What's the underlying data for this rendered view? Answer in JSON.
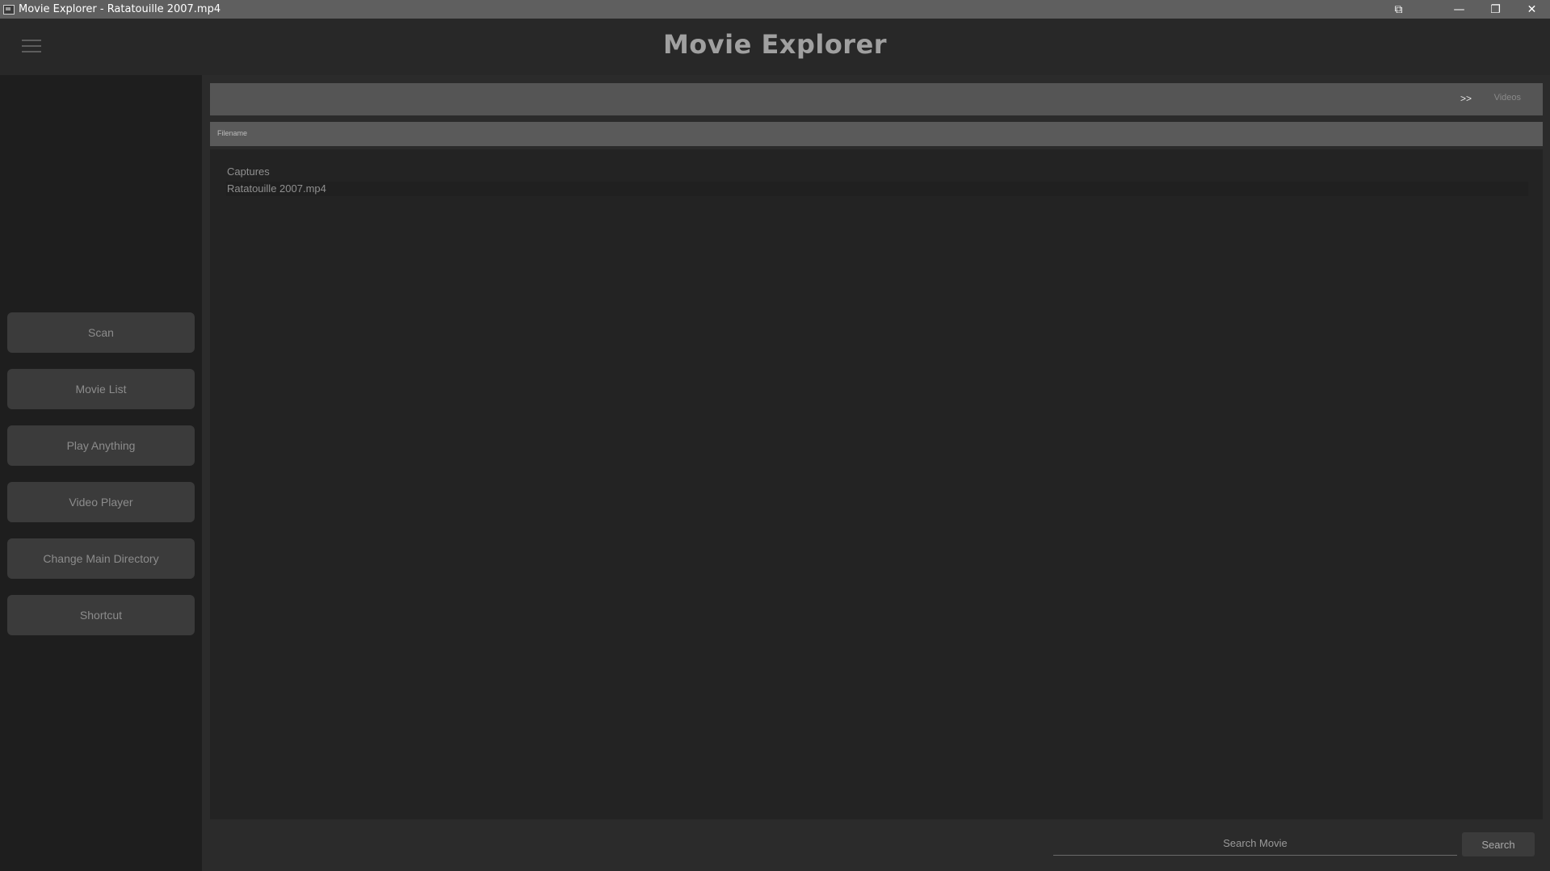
{
  "window": {
    "title": "Movie Explorer - Ratatouille 2007.mp4",
    "controls": {
      "pip": "⧉",
      "minimize": "—",
      "restore": "❐",
      "close": "✕"
    }
  },
  "header": {
    "menu_icon": "hamburger-icon",
    "title": "Movie Explorer"
  },
  "sidebar": {
    "items": [
      {
        "label": "Scan"
      },
      {
        "label": "Movie List"
      },
      {
        "label": "Play Anything"
      },
      {
        "label": "Video Player"
      },
      {
        "label": "Change Main Directory"
      },
      {
        "label": "Shortcut"
      }
    ]
  },
  "main": {
    "breadcrumb": {
      "separator": ">>",
      "items": [
        "Videos"
      ]
    },
    "filter": {
      "label": "Filename"
    },
    "list": [
      {
        "name": "Captures"
      },
      {
        "name": "Ratatouille 2007.mp4"
      }
    ]
  },
  "search": {
    "placeholder": "Search Movie",
    "value": "",
    "button_label": "Search"
  },
  "colors": {
    "titlebar": "#5f5f5f",
    "background": "#2b2b2b",
    "sidebar": "#1e1e1e",
    "button": "#3b3b3b",
    "title_text": "#a0a0a0"
  }
}
